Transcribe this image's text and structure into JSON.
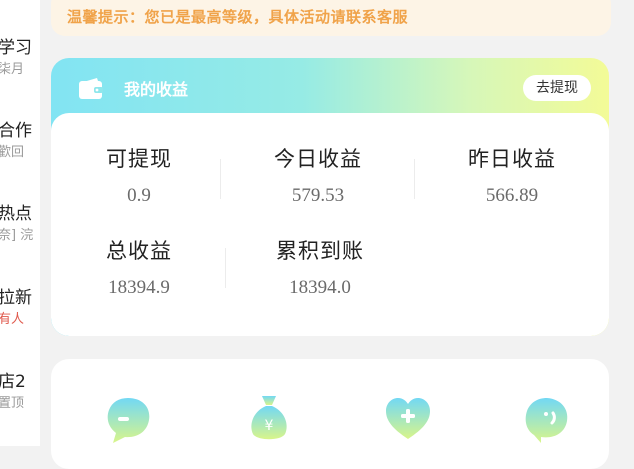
{
  "left_list": [
    {
      "title": "学习",
      "subtitle": "柒月",
      "subtitle_color": "gray"
    },
    {
      "title": "合作",
      "subtitle": "歡回",
      "subtitle_color": "gray"
    },
    {
      "title": "热点",
      "subtitle": "奈] 浣",
      "subtitle_color": "gray"
    },
    {
      "title": "拉新",
      "subtitle": "有人",
      "subtitle_color": "red"
    },
    {
      "title": "店2",
      "subtitle": "置顶",
      "subtitle_color": "gray"
    }
  ],
  "notice": {
    "text": "温馨提示：您已是最高等级，具体活动请联系客服",
    "color": "#f0a34a"
  },
  "earnings": {
    "title": "我的收益",
    "withdraw_label": "去提现",
    "stats": [
      {
        "label": "可提现",
        "value": "0.9"
      },
      {
        "label": "今日收益",
        "value": "579.53"
      },
      {
        "label": "昨日收益",
        "value": "566.89"
      },
      {
        "label": "总收益",
        "value": "18394.9"
      },
      {
        "label": "累积到账",
        "value": "18394.0"
      }
    ]
  },
  "features": [
    {
      "icon": "chat-bubble-icon"
    },
    {
      "icon": "money-bag-icon"
    },
    {
      "icon": "heart-plus-icon"
    },
    {
      "icon": "smile-bubble-icon"
    }
  ],
  "colors": {
    "gradient_start": "#82e4f3",
    "gradient_end": "#f3fb97",
    "background": "#f2f2f2"
  }
}
